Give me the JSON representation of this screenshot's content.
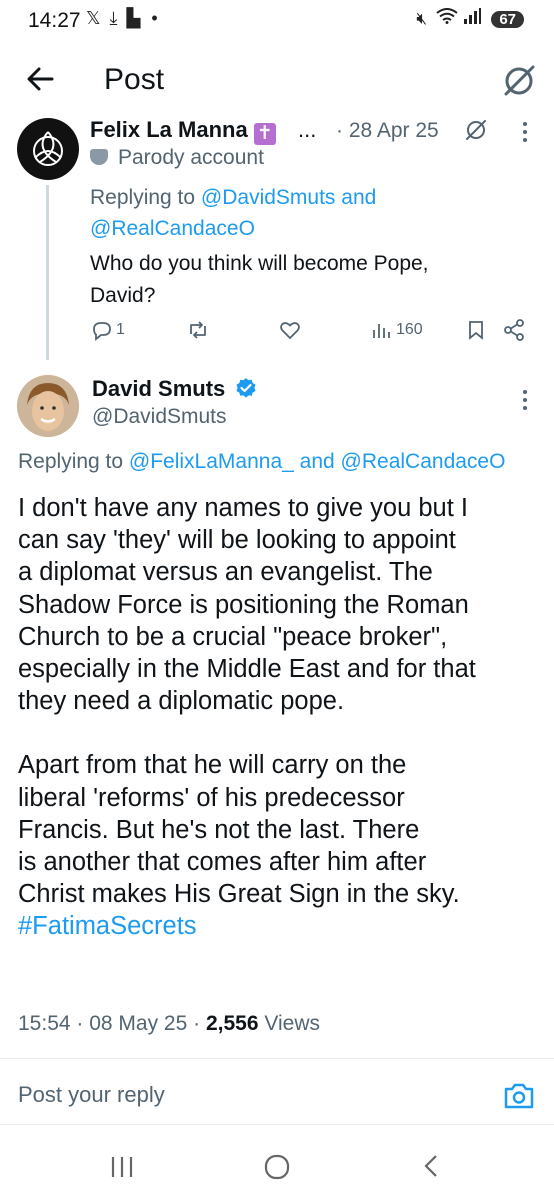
{
  "status_bar": {
    "time": "14:27",
    "left_icons": [
      "x-logo-icon",
      "download-icon",
      "chat-icon",
      "dot-icon"
    ],
    "right_icons": [
      "mute-icon",
      "wifi-icon",
      "signal-icon"
    ],
    "battery": "67"
  },
  "header": {
    "title": "Post"
  },
  "tweet1": {
    "name": "Felix La Manna",
    "name_emoji": "✝",
    "name_ellipsis": "...",
    "date": "· 28 Apr 25",
    "parody_label": "Parody account",
    "replying_prefix": "Replying to",
    "replying_mention1": "@DavidSmuts",
    "replying_and": "and",
    "replying_mention2": "@RealCandaceO",
    "text_line1": "Who do you think will become Pope,",
    "text_line2": "David?",
    "reply_count": "1",
    "views_count": "160"
  },
  "tweet2": {
    "name": "David Smuts",
    "handle": "@DavidSmuts",
    "replying_prefix": "Replying to",
    "replying_mention1": "@FelixLaManna_",
    "replying_and": "and",
    "replying_mention2": "@RealCandaceO",
    "paragraph1": "I don't have any names to give you but I\ncan say 'they' will be looking to appoint\na diplomat versus an evangelist. The\nShadow Force is positioning the Roman\nChurch to be a crucial \"peace broker\",\nespecially in the Middle East and for that\nthey need a diplomatic pope.",
    "paragraph2": "Apart from that he will carry on the\nliberal 'reforms' of his predecessor\nFrancis. But he's not the last. There\nis another that comes after him after\nChrist makes His Great Sign in the sky.",
    "hashtag": "#FatimaSecrets",
    "time": "15:54",
    "date": "08 May 25",
    "views_count": "2,556",
    "views_label": "Views"
  },
  "reply_box": {
    "placeholder": "Post your reply"
  },
  "colors": {
    "link": "#1d9bf0",
    "secondary": "#536471",
    "verified": "#1d9bf0"
  }
}
